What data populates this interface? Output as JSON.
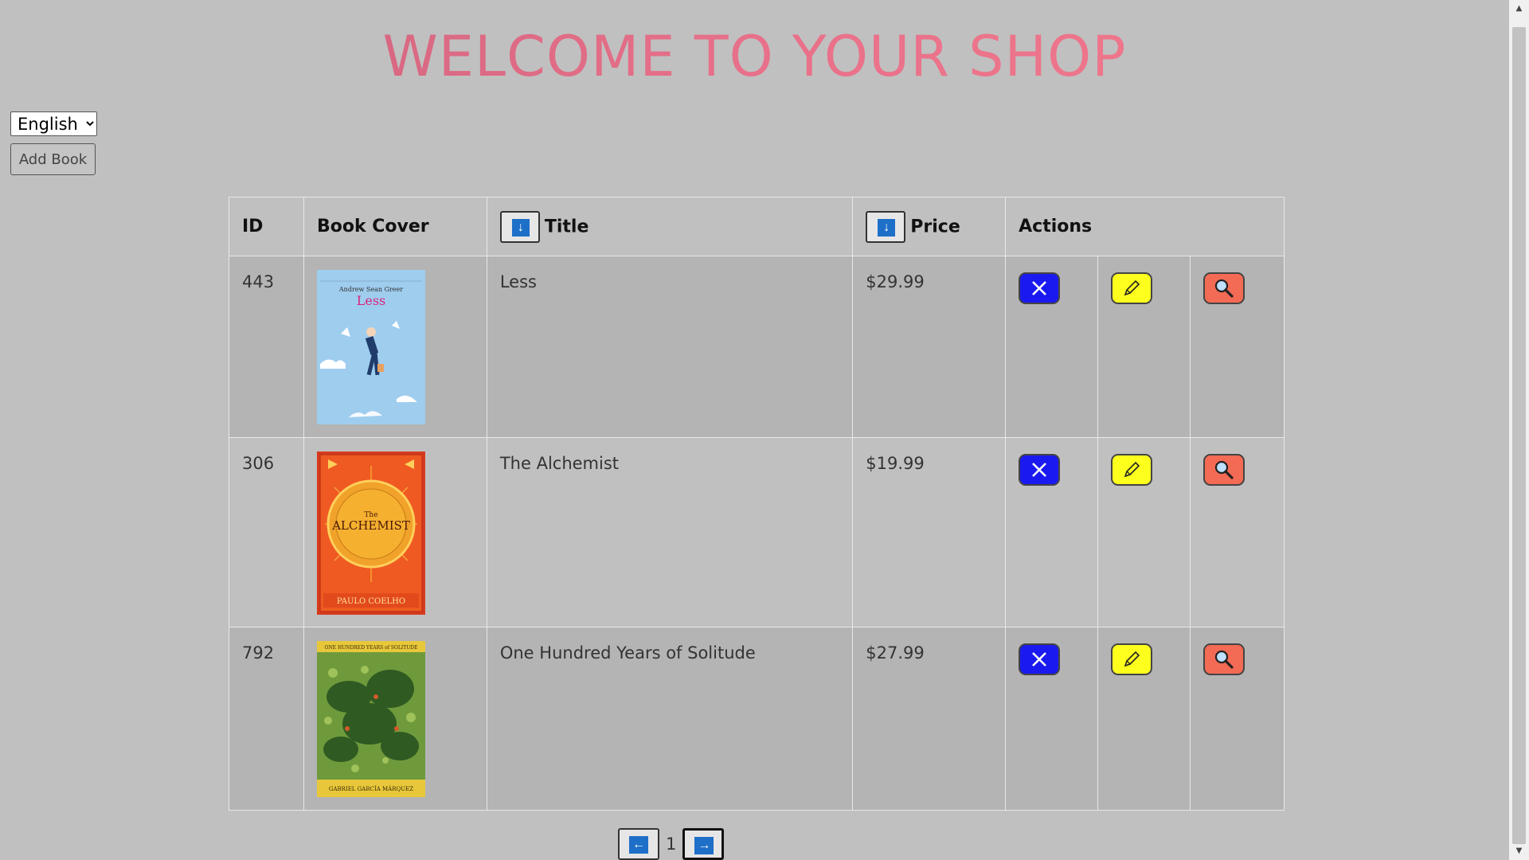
{
  "page": {
    "title": "WELCOME TO YOUR SHOP"
  },
  "language": {
    "selected": "English",
    "options": [
      "English"
    ]
  },
  "toolbar": {
    "add_label": "Add Book"
  },
  "table": {
    "headers": {
      "id": "ID",
      "cover": "Book Cover",
      "title": "Title",
      "price": "Price",
      "actions": "Actions"
    },
    "rows": [
      {
        "id": "443",
        "title": "Less",
        "price": "$29.99",
        "cover_text": "Andrew Sean Greer",
        "cover_title": "Less"
      },
      {
        "id": "306",
        "title": "The Alchemist",
        "price": "$19.99",
        "cover_text": "PAULO COELHO",
        "cover_title": "ALCHEMIST"
      },
      {
        "id": "792",
        "title": "One Hundred Years of Solitude",
        "price": "$27.99",
        "cover_text": "GABRIEL GARCÍA MÁRQUEZ",
        "cover_title": "ONE HUNDRED YEARS of SOLITUDE"
      }
    ]
  },
  "pagination": {
    "current_page": "1"
  },
  "colors": {
    "background": "#c0c0c0",
    "delete": "#1a1af0",
    "edit": "#ffff1e",
    "view": "#f36a55",
    "sort_blue": "#1e6fc8"
  },
  "icons": {
    "sort": "arrow-down-icon",
    "delete": "close-icon",
    "edit": "pencil-icon",
    "view": "magnifier-icon",
    "prev": "arrow-left-icon",
    "next": "arrow-right-icon"
  }
}
